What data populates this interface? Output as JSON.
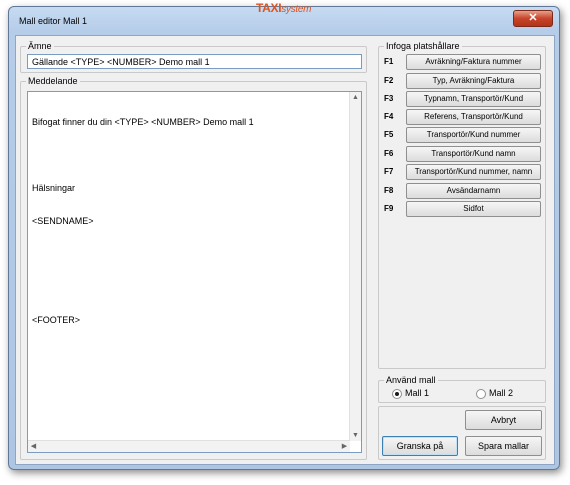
{
  "window": {
    "title": "Mall editor Mall 1",
    "brand_main": "TAXI",
    "brand_sub": "system",
    "close_label": "✕"
  },
  "subject": {
    "legend": "Ämne",
    "value": "Gällande <TYPE> <NUMBER> Demo mall 1"
  },
  "message": {
    "legend": "Meddelande",
    "lines": [
      "Bifogat finner du din <TYPE> <NUMBER> Demo mall 1",
      "",
      "Hälsningar",
      "<SENDNAME>",
      "",
      "",
      "<FOOTER>"
    ]
  },
  "placeholders": {
    "legend": "Infoga platshållare",
    "items": [
      {
        "key": "F1",
        "label": "Avräkning/Faktura nummer"
      },
      {
        "key": "F2",
        "label": "Typ, Avräkning/Faktura"
      },
      {
        "key": "F3",
        "label": "Typnamn, Transportör/Kund"
      },
      {
        "key": "F4",
        "label": "Referens, Transportör/Kund"
      },
      {
        "key": "F5",
        "label": "Transportör/Kund nummer"
      },
      {
        "key": "F6",
        "label": "Transportör/Kund namn"
      },
      {
        "key": "F7",
        "label": "Transportör/Kund nummer, namn"
      },
      {
        "key": "F8",
        "label": "Avsändarnamn"
      },
      {
        "key": "F9",
        "label": "Sidfot"
      }
    ]
  },
  "use_template": {
    "legend": "Använd mall",
    "options": [
      {
        "label": "Mall 1",
        "selected": true
      },
      {
        "label": "Mall 2",
        "selected": false
      }
    ]
  },
  "actions": {
    "cancel": "Avbryt",
    "preview": "Granska på",
    "save": "Spara mallar"
  },
  "colors": {
    "brand": "#e0531e",
    "title_bar": "#b6cde9",
    "close": "#c7442b"
  }
}
